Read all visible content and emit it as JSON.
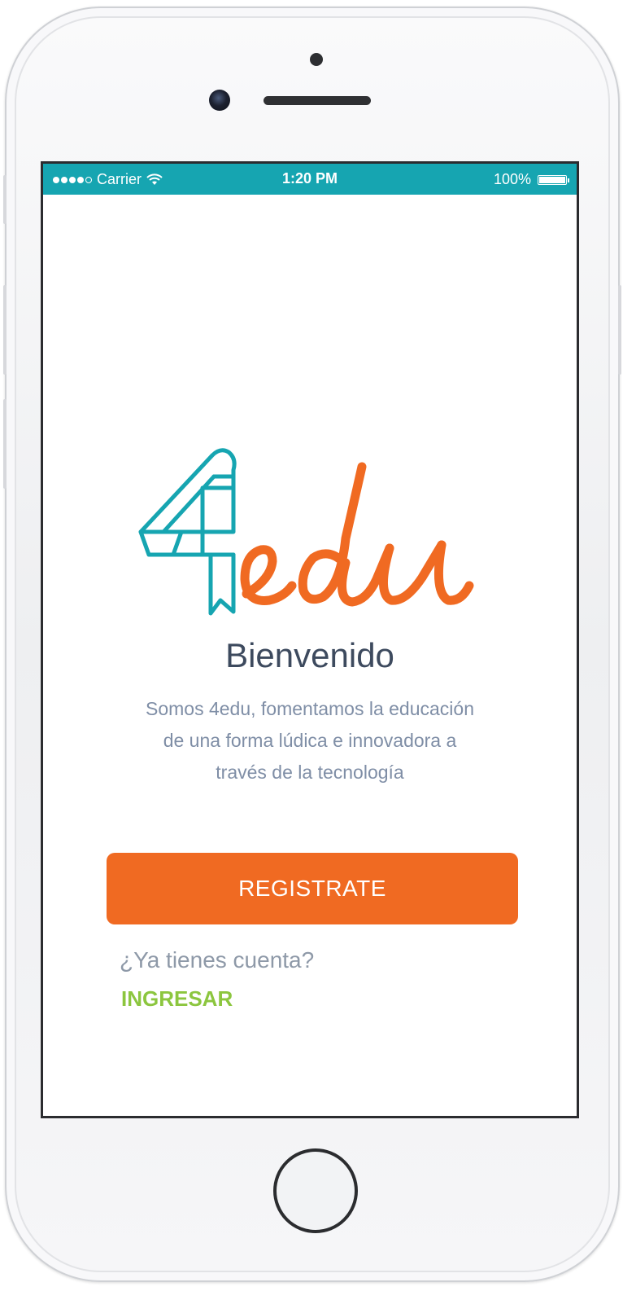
{
  "status_bar": {
    "carrier": "Carrier",
    "time": "1:20 PM",
    "battery": "100%",
    "battery_level": 1.0
  },
  "logo": {
    "text": "4edu",
    "colors": {
      "mark": "#16a5b1",
      "word": "#f06a22"
    }
  },
  "welcome": {
    "title": "Bienvenido",
    "subtitle_lines": [
      "Somos 4edu, fomentamos la educación",
      "de una forma lúdica e innovadora a",
      "través de la tecnología"
    ]
  },
  "actions": {
    "register_label": "REGISTRATE",
    "has_account_question": "¿Ya tienes cuenta?",
    "login_label": "INGRESAR"
  },
  "colors": {
    "status_bar": "#16a5b1",
    "primary_button": "#f06a22",
    "link": "#8cc63f",
    "title": "#3d4a5e",
    "subtitle": "#7f8ea6"
  }
}
